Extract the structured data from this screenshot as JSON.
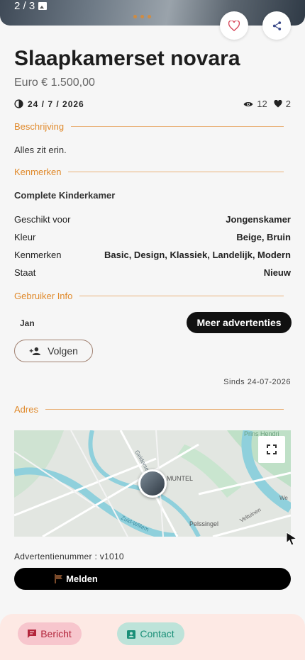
{
  "gallery": {
    "counter": "2 / 3"
  },
  "listing": {
    "title": "Slaapkamerset novara",
    "price": "Euro € 1.500,00",
    "date": "24 / 7 / 2026",
    "views": "12",
    "likes": "2"
  },
  "sections": {
    "description": "Beschrijving",
    "features": "Kenmerken",
    "user_info": "Gebruiker Info",
    "address": "Adres"
  },
  "description_text": "Alles zit erin.",
  "features_title": "Complete Kinderkamer",
  "specs": [
    {
      "label": "Geschikt voor",
      "value": "Jongenskamer"
    },
    {
      "label": "Kleur",
      "value": "Beige, Bruin"
    },
    {
      "label": "Kenmerken",
      "value": "Basic, Design, Klassiek, Landelijk, Modern"
    },
    {
      "label": "Staat",
      "value": "Nieuw"
    }
  ],
  "user": {
    "name": "Jan",
    "more_ads_label": "Meer advertenties",
    "follow_label": "Volgen",
    "since": "Sinds 24-07-2026"
  },
  "map": {
    "labels": [
      "Prins Hendri",
      "Geldersedam",
      "MUNTEL",
      "Zuid-Willem",
      "Pelssingel",
      "Veltuinen",
      "We"
    ]
  },
  "ad_number": "Advertentienummer : v1010",
  "report_label": "Melden",
  "bottom": {
    "message_label": "Bericht",
    "contact_label": "Contact"
  },
  "colors": {
    "accent": "#e08a2c",
    "message": "#b3263c",
    "contact": "#1a8f78"
  }
}
